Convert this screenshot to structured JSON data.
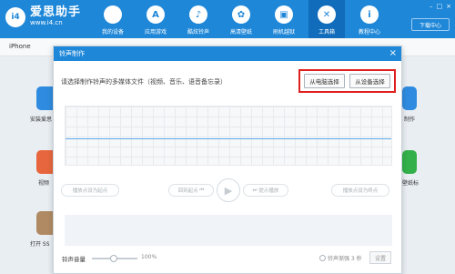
{
  "app": {
    "logo_badge": "i4",
    "title": "爱思助手",
    "url": "www.i4.cn",
    "download_label": "下载中心"
  },
  "nav": [
    {
      "label": "我的设备",
      "icon": "apple-icon",
      "glyph": ""
    },
    {
      "label": "应用游戏",
      "icon": "app-store-icon",
      "glyph": "A"
    },
    {
      "label": "酷炫铃声",
      "icon": "bell-icon",
      "glyph": "♪"
    },
    {
      "label": "高清壁纸",
      "icon": "wallpaper-icon",
      "glyph": "✿"
    },
    {
      "label": "刷机越狱",
      "icon": "box-icon",
      "glyph": "▣"
    },
    {
      "label": "工具箱",
      "icon": "tools-icon",
      "glyph": "✕"
    },
    {
      "label": "教程中心",
      "icon": "info-icon",
      "glyph": "i"
    }
  ],
  "device": {
    "name": "iPhone"
  },
  "background_labels": [
    "安装爱思",
    "视频",
    "打开 SS",
    "制作",
    "壁纸标"
  ],
  "dialog": {
    "title": "铃声制作",
    "hint": "请选择制作铃声的多媒体文件（视频、音乐、语音备忘录）",
    "from_computer": "从电脑选择",
    "from_device": "从设备选择",
    "set_start": "播放点设为起点",
    "back_to_start": "回到起点",
    "preview": "提示播放",
    "set_end": "播放点设为终点",
    "volume_label": "铃声音量",
    "volume_pct": "100%",
    "fade_label": "铃声渐强 3 秒",
    "settings_btn": "设置"
  },
  "colors": {
    "brand": "#1e87d8",
    "highlight": "#e02020"
  }
}
